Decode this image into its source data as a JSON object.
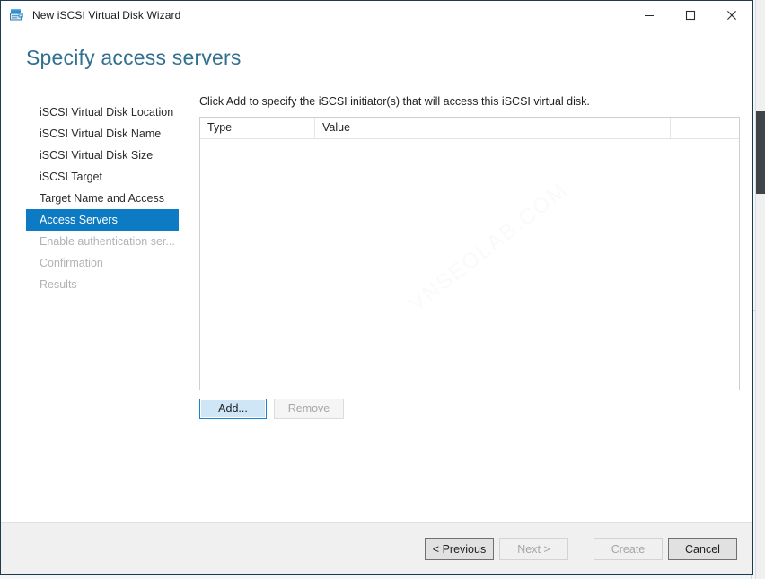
{
  "window": {
    "title": "New iSCSI Virtual Disk Wizard",
    "icon": "iscsi-virtual-disk-icon",
    "controls": {
      "minimize": "minimize-icon",
      "maximize": "maximize-icon",
      "close": "close-icon"
    }
  },
  "page": {
    "title": "Specify access servers",
    "title_color": "#31708f"
  },
  "sidebar": {
    "items": [
      {
        "label": "iSCSI Virtual Disk Location",
        "state": "normal"
      },
      {
        "label": "iSCSI Virtual Disk Name",
        "state": "normal"
      },
      {
        "label": "iSCSI Virtual Disk Size",
        "state": "normal"
      },
      {
        "label": "iSCSI Target",
        "state": "normal"
      },
      {
        "label": "Target Name and Access",
        "state": "normal"
      },
      {
        "label": "Access Servers",
        "state": "selected"
      },
      {
        "label": "Enable authentication ser...",
        "state": "disabled"
      },
      {
        "label": "Confirmation",
        "state": "disabled"
      },
      {
        "label": "Results",
        "state": "disabled"
      }
    ],
    "selected_color": "#0d7ac4"
  },
  "main": {
    "instruction": "Click Add to specify the iSCSI initiator(s) that will access this iSCSI virtual disk.",
    "table": {
      "columns": [
        "Type",
        "Value",
        ""
      ],
      "rows": []
    },
    "watermark": "VNSEOLAB.COM",
    "actions": [
      {
        "label": "Add...",
        "state": "focused"
      },
      {
        "label": "Remove",
        "state": "disabled"
      }
    ]
  },
  "footer": {
    "buttons": [
      {
        "label": "< Previous",
        "state": "enabled"
      },
      {
        "label": "Next >",
        "state": "disabled"
      },
      {
        "label": "Create",
        "state": "disabled"
      },
      {
        "label": "Cancel",
        "state": "enabled"
      }
    ]
  }
}
